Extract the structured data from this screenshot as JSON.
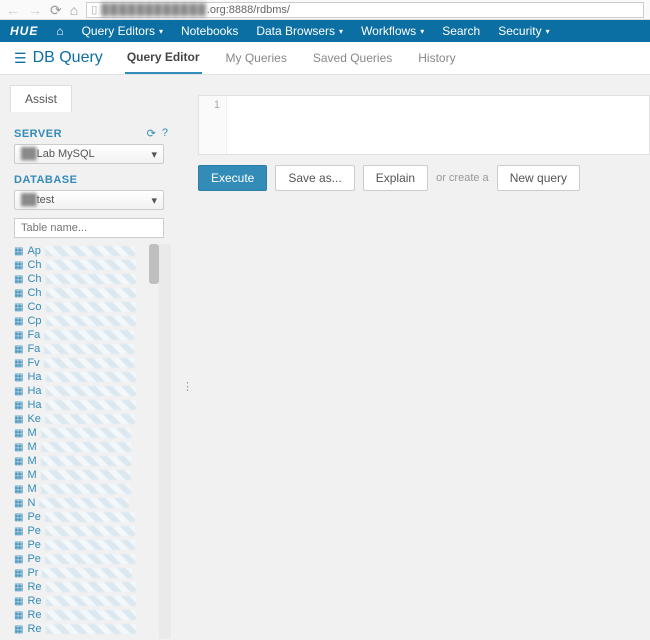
{
  "browser": {
    "url_prefix_blurred": "████████████",
    "url_suffix": ".org:8888/rdbms/"
  },
  "topnav": {
    "logo": "HUE",
    "items": [
      {
        "label": "Query Editors",
        "has_caret": true
      },
      {
        "label": "Notebooks",
        "has_caret": false
      },
      {
        "label": "Data Browsers",
        "has_caret": true
      },
      {
        "label": "Workflows",
        "has_caret": true
      },
      {
        "label": "Search",
        "has_caret": false
      },
      {
        "label": "Security",
        "has_caret": true
      }
    ]
  },
  "subnav": {
    "title": "DB Query",
    "tabs": [
      {
        "label": "Query Editor",
        "active": true
      },
      {
        "label": "My Queries",
        "active": false
      },
      {
        "label": "Saved Queries",
        "active": false
      },
      {
        "label": "History",
        "active": false
      }
    ]
  },
  "assist": {
    "tab_label": "Assist",
    "server_label": "SERVER",
    "server_value_suffix": "Lab MySQL",
    "database_label": "DATABASE",
    "database_value_suffix": "test",
    "search_placeholder": "Table name...",
    "table_prefixes": [
      "Ap",
      "Ch",
      "Ch",
      "Ch",
      "Co",
      "Cp",
      "Fa",
      "Fa",
      "Fv",
      "Ha",
      "Ha",
      "Ha",
      "Ke",
      "M",
      "M",
      "M",
      "M",
      "M",
      "N",
      "Pe",
      "Pe",
      "Pe",
      "Pe",
      "Pr",
      "Re",
      "Re",
      "Re",
      "Re"
    ]
  },
  "editor": {
    "line_number": "1"
  },
  "actions": {
    "execute": "Execute",
    "save_as": "Save as...",
    "explain": "Explain",
    "or_create": "or create a",
    "new_query": "New query"
  }
}
